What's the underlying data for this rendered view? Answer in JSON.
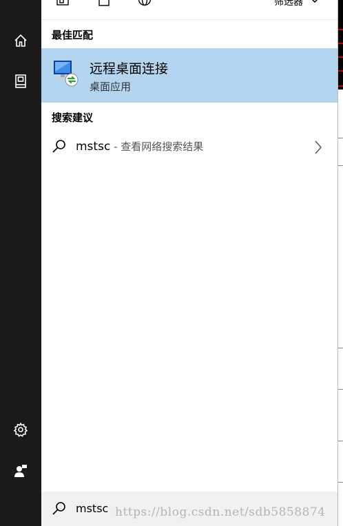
{
  "topbar": {
    "filter_label": "筛选器"
  },
  "best_match": {
    "section_title": "最佳匹配",
    "app_name": "远程桌面连接",
    "app_type": "桌面应用"
  },
  "suggestions": {
    "section_title": "搜索建议",
    "items": [
      {
        "query": "mstsc",
        "description": " - 查看网络搜索结果"
      }
    ]
  },
  "search": {
    "value": "mstsc"
  },
  "watermark": "https://blog.csdn.net/sdb5858874",
  "icons": [
    "menu-icon",
    "home-icon",
    "documents-icon",
    "settings-icon",
    "user-feedback-icon",
    "apps-icon",
    "document-icon",
    "web-icon",
    "chevron-down-icon",
    "remote-desktop-icon",
    "search-icon",
    "chevron-right-icon"
  ],
  "colors": {
    "rail": "#1a1a1a",
    "selection": "#b4d5f0",
    "searchbox": "#f1f1f1"
  }
}
